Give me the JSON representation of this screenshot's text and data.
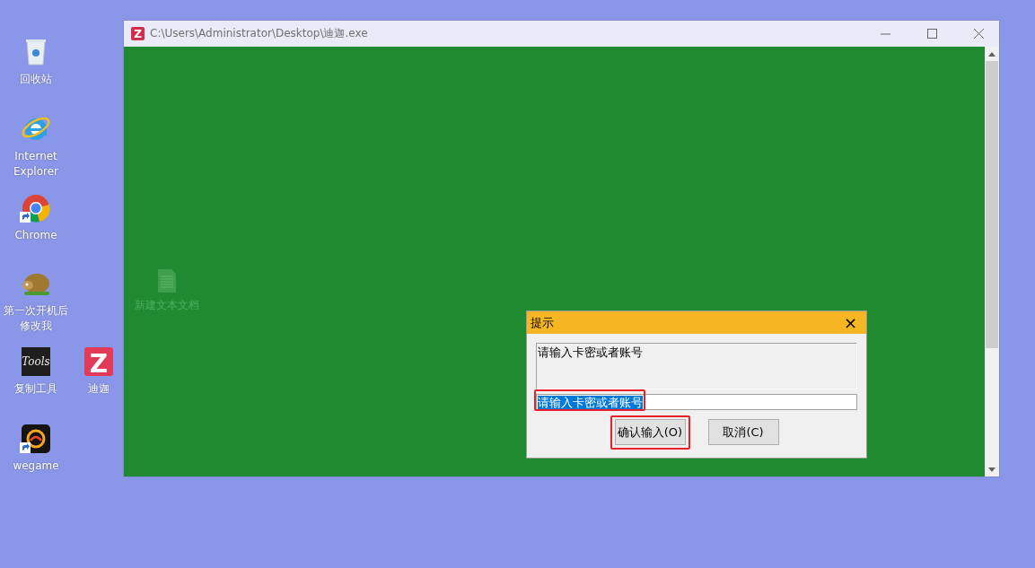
{
  "desktop_icons": [
    {
      "kind": "recycle-bin",
      "label": "回收站",
      "shortcut": false
    },
    {
      "kind": "browser-e",
      "label": "Internet Explorer",
      "shortcut": false
    },
    {
      "kind": "browser-ring",
      "label": "Chrome",
      "shortcut": true
    },
    {
      "kind": "creature",
      "label": "第一次开机后修改我",
      "shortcut": false
    },
    {
      "kind": "tools",
      "label": "复制工具",
      "logo_text": "Tools",
      "shortcut": false
    },
    {
      "kind": "z-app",
      "label": "迪迦",
      "logo_text": "Z",
      "shortcut": false
    },
    {
      "kind": "wegame",
      "label": "wegame",
      "shortcut": true
    }
  ],
  "window": {
    "title": "C:\\Users\\Administrator\\Desktop\\迪迦.exe",
    "logo_text": "Z",
    "faded_file": {
      "label": "新建文本文档"
    },
    "dialog": {
      "title": "提示",
      "close": "×",
      "message": "请输入卡密或者账号",
      "input": {
        "value": "请输入卡密或者账号",
        "selected": true,
        "highlighted": true
      },
      "buttons": [
        {
          "label": "确认输入(O)",
          "highlighted": true
        },
        {
          "label": "取消(C)",
          "highlighted": false
        }
      ]
    }
  }
}
